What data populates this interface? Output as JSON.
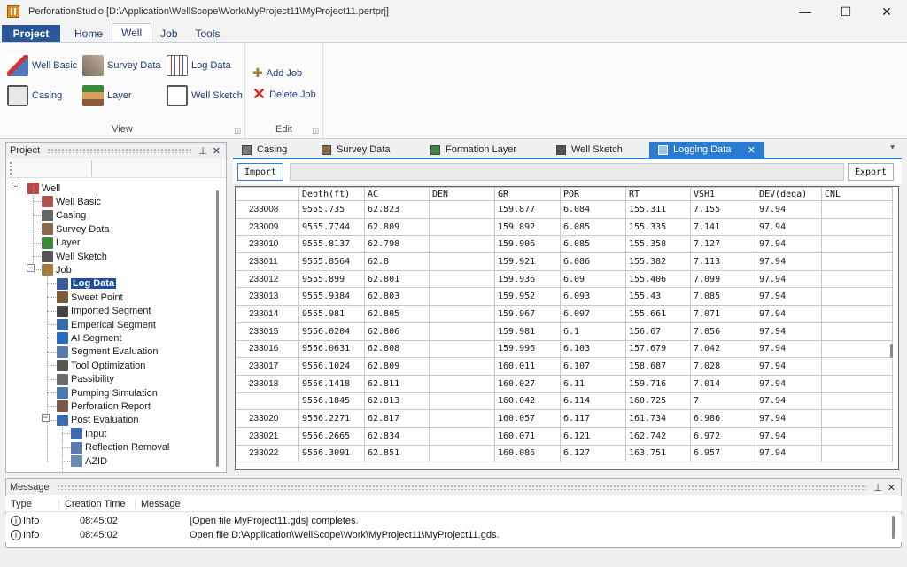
{
  "window": {
    "title": "PerforationStudio [D:\\Application\\WellScope\\Work\\MyProject11\\MyProject11.pertprj]",
    "min": "—",
    "max": "☐",
    "close": "✕"
  },
  "menu": {
    "project": "Project",
    "tabs": [
      "Home",
      "Well",
      "Job",
      "Tools"
    ]
  },
  "ribbon": {
    "view": {
      "label": "View",
      "items": [
        "Well Basic",
        "Casing",
        "Survey Data",
        "Layer",
        "Log Data",
        "Well Sketch"
      ]
    },
    "edit": {
      "label": "Edit",
      "items": [
        "Add Job",
        "Delete Job"
      ]
    }
  },
  "project_panel": {
    "title": "Project",
    "pin": "📌",
    "close": "✕",
    "tree": [
      {
        "label": "Well",
        "level": 0,
        "icon": "well-icon",
        "color": "#b44"
      },
      {
        "label": "Well Basic",
        "level": 1,
        "icon": "well-basic-icon",
        "color": "#a55"
      },
      {
        "label": "Casing",
        "level": 1,
        "icon": "casing-icon",
        "color": "#666"
      },
      {
        "label": "Survey Data",
        "level": 1,
        "icon": "survey-icon",
        "color": "#8a6a4a"
      },
      {
        "label": "Layer",
        "level": 1,
        "icon": "layer-icon",
        "color": "#3a8a3a"
      },
      {
        "label": "Well Sketch",
        "level": 1,
        "icon": "sketch-icon",
        "color": "#555"
      },
      {
        "label": "Job",
        "level": 1,
        "icon": "job-icon",
        "color": "#a87a3a"
      },
      {
        "label": "Log Data",
        "level": 2,
        "icon": "log-data-icon",
        "color": "#3a5a9a",
        "selected": true
      },
      {
        "label": "Sweet Point",
        "level": 2,
        "icon": "sweet-point-icon",
        "color": "#7a5a3a"
      },
      {
        "label": "Imported Segment",
        "level": 2,
        "icon": "imported-segment-icon",
        "color": "#444"
      },
      {
        "label": "Emperical Segment",
        "level": 2,
        "icon": "emperical-segment-icon",
        "color": "#3a6aaa"
      },
      {
        "label": "AI Segment",
        "level": 2,
        "icon": "ai-segment-icon",
        "color": "#2a6ac0"
      },
      {
        "label": "Segment Evaluation",
        "level": 2,
        "icon": "segment-evaluation-icon",
        "color": "#5a7aaa"
      },
      {
        "label": "Tool Optimization",
        "level": 2,
        "icon": "tool-optimization-icon",
        "color": "#555"
      },
      {
        "label": "Passibility",
        "level": 2,
        "icon": "passibility-icon",
        "color": "#6a6a6a"
      },
      {
        "label": "Pumping Simulation",
        "level": 2,
        "icon": "pumping-simulation-icon",
        "color": "#4a7ab0"
      },
      {
        "label": "Perforation Report",
        "level": 2,
        "icon": "perforation-report-icon",
        "color": "#7a5a4a"
      },
      {
        "label": "Post Evaluation",
        "level": 2,
        "icon": "post-evaluation-icon",
        "color": "#3a6ab0"
      },
      {
        "label": "Input",
        "level": 3,
        "icon": "input-icon",
        "color": "#3a6ab0"
      },
      {
        "label": "Reflection Removal",
        "level": 3,
        "icon": "reflection-removal-icon",
        "color": "#5a7ab0"
      },
      {
        "label": "AZID",
        "level": 3,
        "icon": "azid-icon",
        "color": "#6a8ab0"
      }
    ]
  },
  "doc_tabs": [
    {
      "label": "Casing",
      "icon": "casing-icon"
    },
    {
      "label": "Survey Data",
      "icon": "survey-icon"
    },
    {
      "label": "Formation Layer",
      "icon": "layer-icon"
    },
    {
      "label": "Well Sketch",
      "icon": "sketch-icon"
    },
    {
      "label": "Logging Data",
      "icon": "log-data-icon",
      "active": true,
      "close": "✕"
    }
  ],
  "doc_tab_menu": "⯆",
  "toolbar": {
    "import": "Import",
    "export": "Export"
  },
  "grid": {
    "columns": [
      "",
      "Depth(ft)",
      "AC",
      "DEN",
      "GR",
      "POR",
      "RT",
      "VSH1",
      "DEV(dega)",
      "CNL"
    ],
    "rows": [
      [
        "233008",
        "9555.735",
        "62.823",
        "",
        "159.877",
        "6.084",
        "155.311",
        "7.155",
        "97.94",
        ""
      ],
      [
        "233009",
        "9555.7744",
        "62.809",
        "",
        "159.892",
        "6.085",
        "155.335",
        "7.141",
        "97.94",
        ""
      ],
      [
        "233010",
        "9555.8137",
        "62.798",
        "",
        "159.906",
        "6.085",
        "155.358",
        "7.127",
        "97.94",
        ""
      ],
      [
        "233011",
        "9555.8564",
        "62.8",
        "",
        "159.921",
        "6.086",
        "155.382",
        "7.113",
        "97.94",
        ""
      ],
      [
        "233012",
        "9555.899",
        "62.801",
        "",
        "159.936",
        "6.09",
        "155.406",
        "7.099",
        "97.94",
        ""
      ],
      [
        "233013",
        "9555.9384",
        "62.803",
        "",
        "159.952",
        "6.093",
        "155.43",
        "7.085",
        "97.94",
        ""
      ],
      [
        "233014",
        "9555.981",
        "62.805",
        "",
        "159.967",
        "6.097",
        "155.661",
        "7.071",
        "97.94",
        ""
      ],
      [
        "233015",
        "9556.0204",
        "62.806",
        "",
        "159.981",
        "6.1",
        "156.67",
        "7.056",
        "97.94",
        ""
      ],
      [
        "233016",
        "9556.0631",
        "62.808",
        "",
        "159.996",
        "6.103",
        "157.679",
        "7.042",
        "97.94",
        ""
      ],
      [
        "233017",
        "9556.1024",
        "62.809",
        "",
        "160.011",
        "6.107",
        "158.687",
        "7.028",
        "97.94",
        ""
      ],
      [
        "233018",
        "9556.1418",
        "62.811",
        "",
        "160.027",
        "6.11",
        "159.716",
        "7.014",
        "97.94",
        ""
      ],
      [
        "",
        "9556.1845",
        "62.813",
        "",
        "160.042",
        "6.114",
        "160.725",
        "7",
        "97.94",
        ""
      ],
      [
        "233020",
        "9556.2271",
        "62.817",
        "",
        "160.057",
        "6.117",
        "161.734",
        "6.986",
        "97.94",
        ""
      ],
      [
        "233021",
        "9556.2665",
        "62.834",
        "",
        "160.071",
        "6.121",
        "162.742",
        "6.972",
        "97.94",
        ""
      ],
      [
        "233022",
        "9556.3091",
        "62.851",
        "",
        "160.086",
        "6.127",
        "163.751",
        "6.957",
        "97.94",
        ""
      ]
    ]
  },
  "message_panel": {
    "title": "Message",
    "pin": "📌",
    "close": "✕",
    "columns": [
      "Type",
      "Creation Time",
      "Message"
    ],
    "rows": [
      {
        "type": "Info",
        "time": "08:45:02",
        "message": "[Open file MyProject11.gds] completes."
      },
      {
        "type": "Info",
        "time": "08:45:02",
        "message": "Open file D:\\Application\\WellScope\\Work\\MyProject11\\MyProject11.gds."
      }
    ]
  }
}
